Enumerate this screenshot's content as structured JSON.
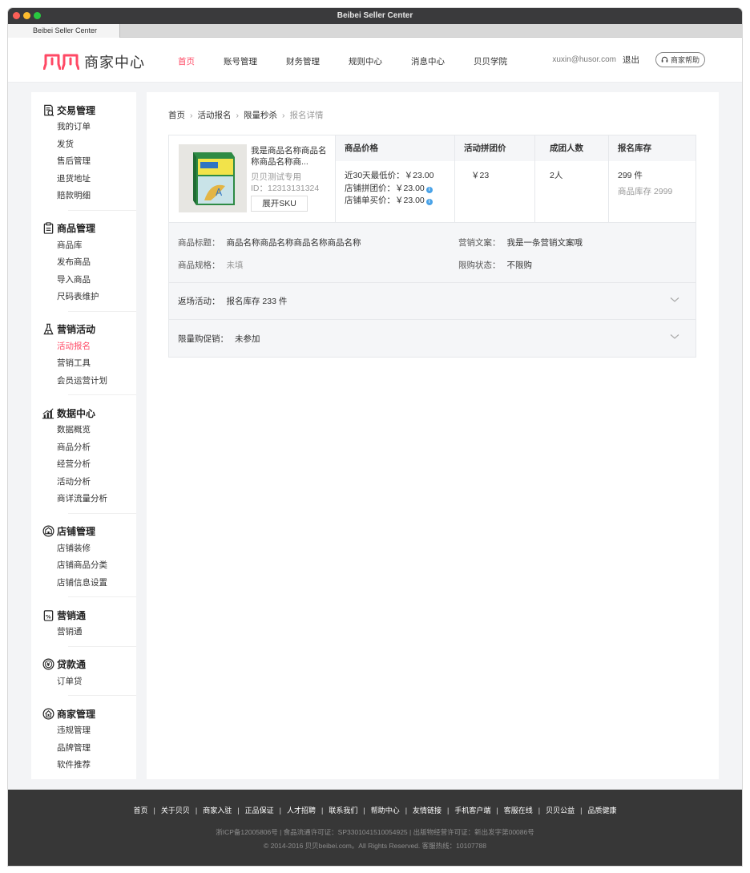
{
  "window": {
    "title": "Beibei Seller Center",
    "tab": "Beibei Seller Center"
  },
  "header": {
    "logo_text": "商家中心",
    "nav": [
      "首页",
      "账号管理",
      "财务管理",
      "规则中心",
      "消息中心",
      "贝贝学院"
    ],
    "active_nav": 0,
    "user_email": "xuxin@husor.com",
    "logout": "退出",
    "help": "商家帮助"
  },
  "colors": {
    "accent": "#ff4965",
    "info": "#4aa3e8",
    "footer_bg": "#373737"
  },
  "sidebar": {
    "groups": [
      {
        "title": "交易管理",
        "icon": "receipt-icon",
        "items": [
          "我的订单",
          "发货",
          "售后管理",
          "退货地址",
          "赔款明细"
        ]
      },
      {
        "title": "商品管理",
        "icon": "clipboard-icon",
        "items": [
          "商品库",
          "发布商品",
          "导入商品",
          "尺码表维护"
        ]
      },
      {
        "title": "营销活动",
        "icon": "flask-icon",
        "items": [
          "活动报名",
          "营销工具",
          "会员运营计划"
        ]
      },
      {
        "title": "数据中心",
        "icon": "chart-icon",
        "items": [
          "数据概览",
          "商品分析",
          "经营分析",
          "活动分析",
          "商详流量分析"
        ]
      },
      {
        "title": "店铺管理",
        "icon": "shop-icon",
        "items": [
          "店铺装修",
          "店铺商品分类",
          "店铺信息设置"
        ]
      },
      {
        "title": "营销通",
        "icon": "percent-tag-icon",
        "items": [
          "营销通"
        ]
      },
      {
        "title": "贷款通",
        "icon": "coin-icon",
        "items": [
          "订单贷"
        ]
      },
      {
        "title": "商家管理",
        "icon": "house-icon",
        "items": [
          "违规管理",
          "品牌管理",
          "软件推荐"
        ]
      }
    ],
    "active_item": "活动报名"
  },
  "breadcrumb": [
    "首页",
    "活动报名",
    "限量秒杀",
    "报名详情"
  ],
  "product": {
    "name": "我是商品名称商品名称商品名称商...",
    "shop_tag": "贝贝测试专用",
    "id_label": "ID：12313131324",
    "sku_button": "展开SKU"
  },
  "columns": {
    "price": {
      "header": "商品价格",
      "lines": [
        "近30天最低价：￥23.00",
        "店铺拼团价：￥23.00",
        "店铺单买价：￥23.00"
      ]
    },
    "group_price": {
      "header": "活动拼团价",
      "value": "￥23"
    },
    "group_size": {
      "header": "成团人数",
      "value": "2人"
    },
    "stock": {
      "header": "报名库存",
      "value": "299 件",
      "sub": "商品库存 2999"
    }
  },
  "details": {
    "title_label": "商品标题：",
    "title_value": "商品名称商品名称商品名称商品名称",
    "copy_label": "营销文案：",
    "copy_value": "我是一条营销文案哦",
    "spec_label": "商品规格：",
    "spec_value": "未填",
    "limit_label": "限购状态：",
    "limit_value": "不限购"
  },
  "folds": [
    {
      "label": "返场活动：",
      "value": "报名库存 233 件"
    },
    {
      "label": "限量购促销：",
      "value": "未参加"
    }
  ],
  "footer": {
    "links": [
      "首页",
      "关于贝贝",
      "商家入驻",
      "正品保证",
      "人才招聘",
      "联系我们",
      "帮助中心",
      "友情链接",
      "手机客户端",
      "客服在线",
      "贝贝公益",
      "品质健康"
    ],
    "icp": "浙ICP备12005806号 | 食品流通许可证：SP3301041510054925 | 出版物经营许可证：新出发字第00086号",
    "copyright": "© 2014-2016 贝贝beibei.com。All Rights Reserved. 客服热线：10107788"
  }
}
